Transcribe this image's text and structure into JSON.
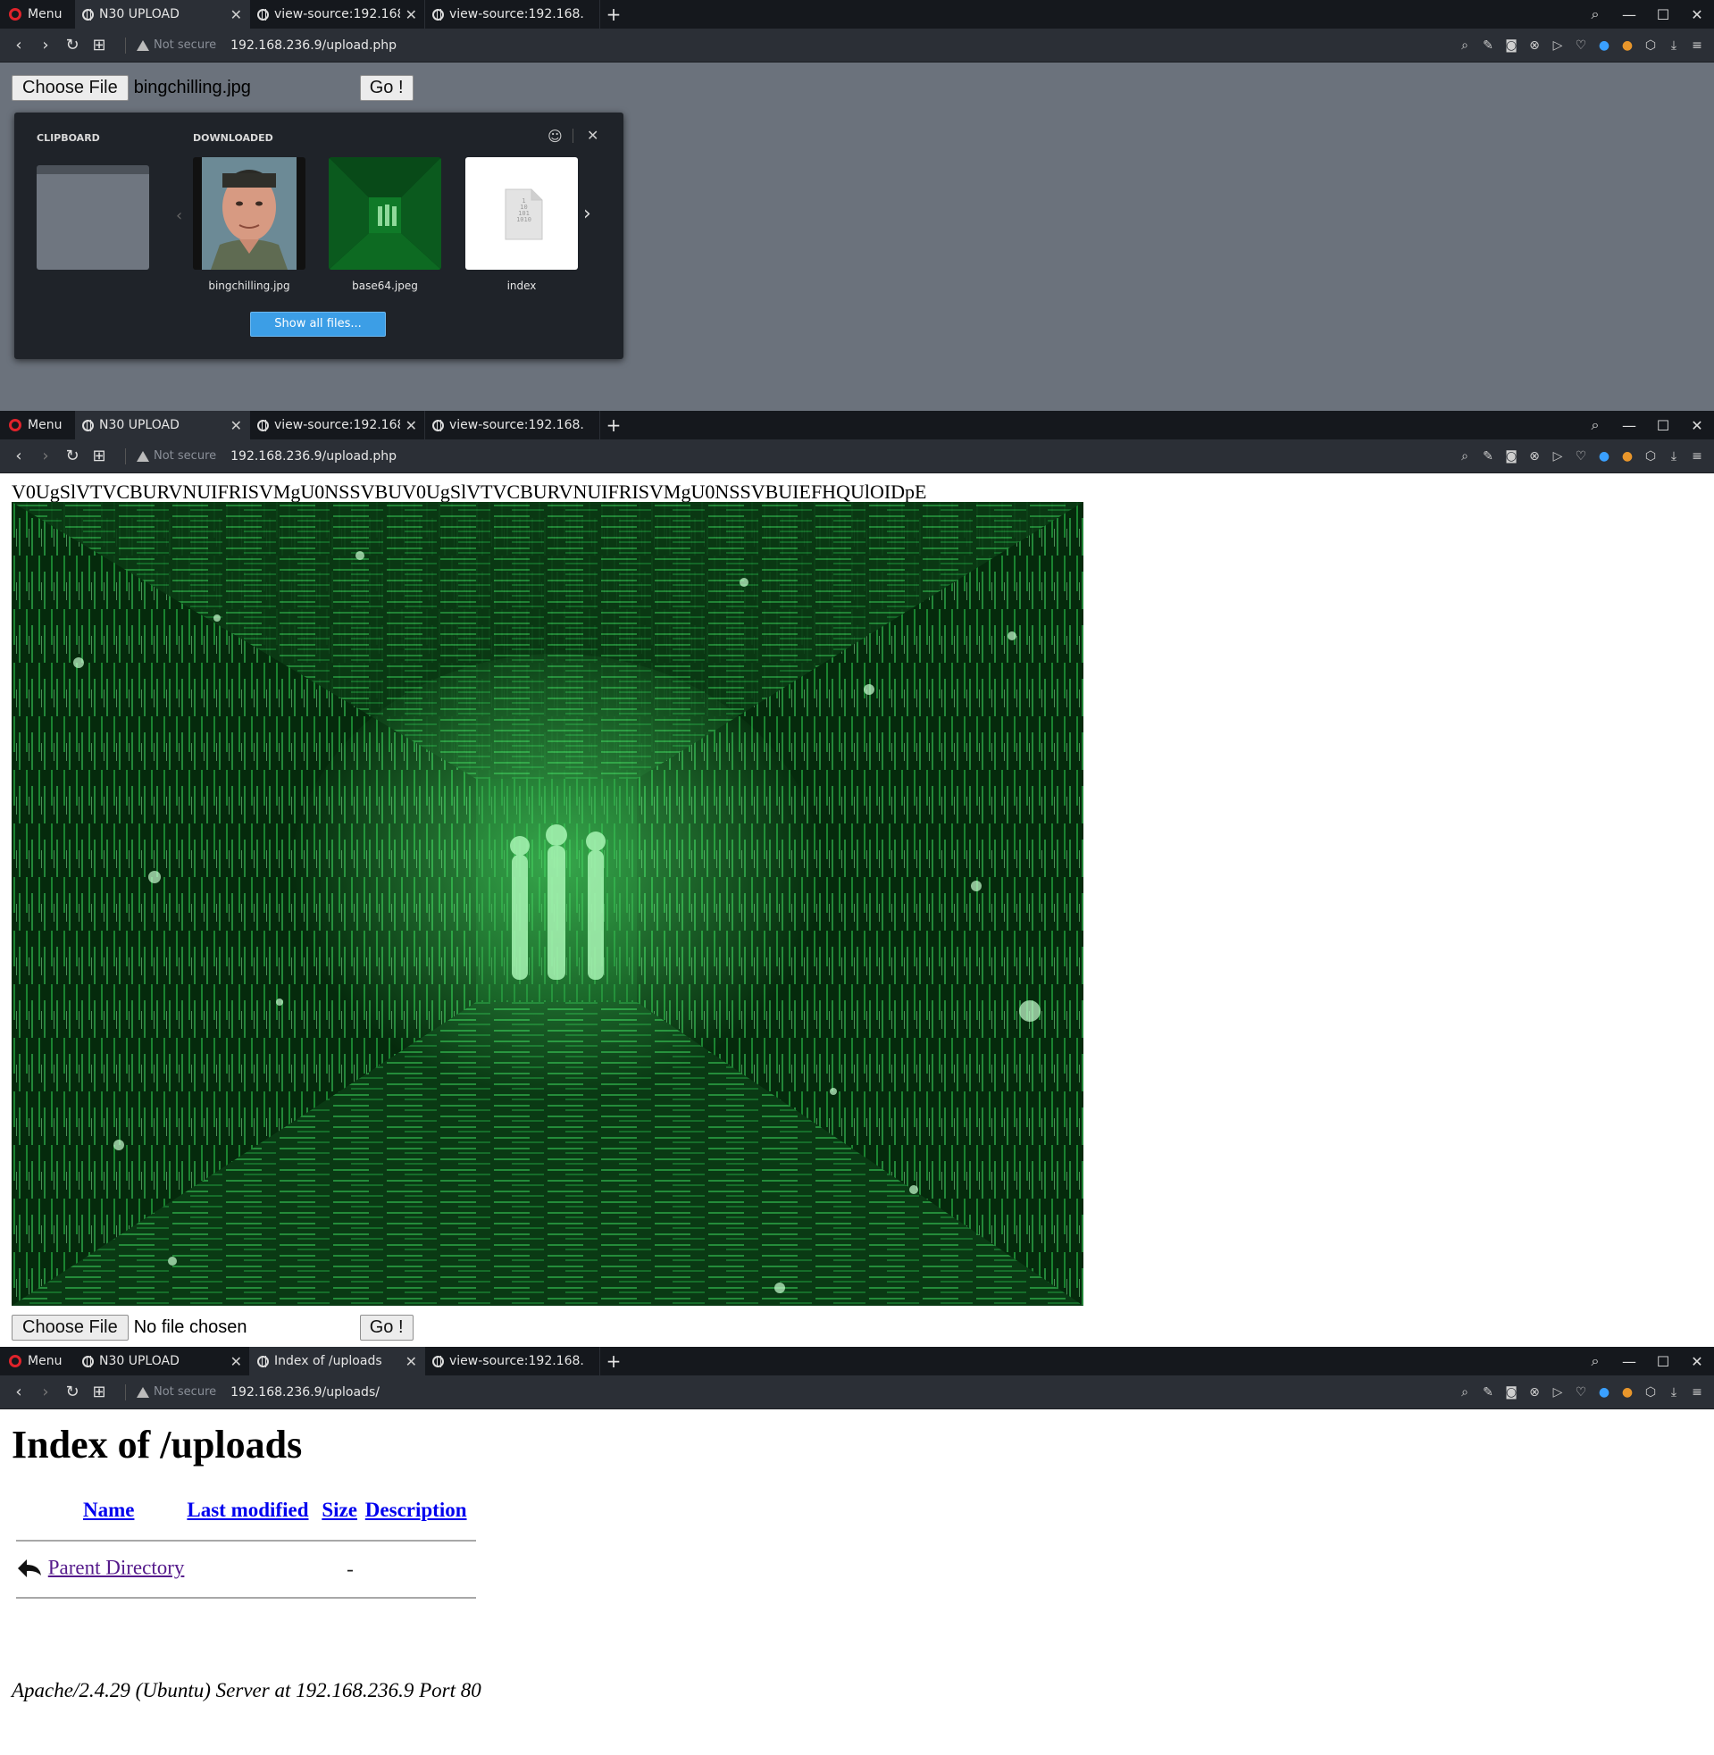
{
  "browser": {
    "menu_label": "Menu",
    "tab_close_glyph": "✕",
    "new_tab_glyph": "+",
    "window_controls": [
      "⌕",
      "—",
      "☐",
      "✕"
    ],
    "nav": {
      "back": "‹",
      "forward": "›",
      "reload": "↻",
      "speed_dial": "⊞"
    },
    "right_icons": [
      "⌕",
      "✎",
      "◙",
      "⊗",
      "▷",
      "♡",
      "●",
      "●",
      "⬡",
      "⤓",
      "≡"
    ],
    "right_icon_names": [
      "lens-icon",
      "edit-icon",
      "snapshot-icon",
      "adblock-icon",
      "send-icon",
      "heart-icon",
      "vpn-icon",
      "cookie-icon",
      "cube-icon",
      "download-icon",
      "menu-lines-icon"
    ],
    "secure_label": "Not secure"
  },
  "window1": {
    "tabs": [
      {
        "title": "N30 UPLOAD",
        "active": true
      },
      {
        "title": "view-source:192.168.",
        "active": false
      },
      {
        "title": "view-source:192.168.",
        "active": false
      }
    ],
    "url": "192.168.236.9/upload.php",
    "choose_file_label": "Choose File",
    "file_name": "bingchilling.jpg",
    "go_label": "Go !",
    "popup": {
      "clipboard_label": "CLIPBOARD",
      "downloaded_label": "DOWNLOADED",
      "files": [
        {
          "name": "bingchilling.jpg"
        },
        {
          "name": "base64.jpeg"
        },
        {
          "name": "index"
        }
      ],
      "binary_icon_text": [
        "1",
        "10",
        "101",
        "1010"
      ],
      "show_all_label": "Show all files..."
    }
  },
  "window2": {
    "tabs": [
      {
        "title": "N30 UPLOAD",
        "active": true
      },
      {
        "title": "view-source:192.168.",
        "active": false
      },
      {
        "title": "view-source:192.168.",
        "active": false
      }
    ],
    "url": "192.168.236.9/upload.php",
    "base64_text": "V0UgSlVTVCBURVNUIFRISVMgU0NSSVBUV0UgSlVTVCBURVNUIFRISVMgU0NSSVBUIEFHQUlOIDpE",
    "choose_file_label": "Choose File",
    "file_name": "No file chosen",
    "go_label": "Go !"
  },
  "window3": {
    "tabs": [
      {
        "title": "N30 UPLOAD",
        "active": false
      },
      {
        "title": "Index of /uploads",
        "active": true
      },
      {
        "title": "view-source:192.168.",
        "active": false
      }
    ],
    "url": "192.168.236.9/uploads/",
    "heading": "Index of /uploads",
    "columns": [
      "Name",
      "Last modified",
      "Size",
      "Description"
    ],
    "parent_label": "Parent Directory",
    "parent_size": "-",
    "footer": "Apache/2.4.29 (Ubuntu) Server at 192.168.236.9 Port 80"
  }
}
